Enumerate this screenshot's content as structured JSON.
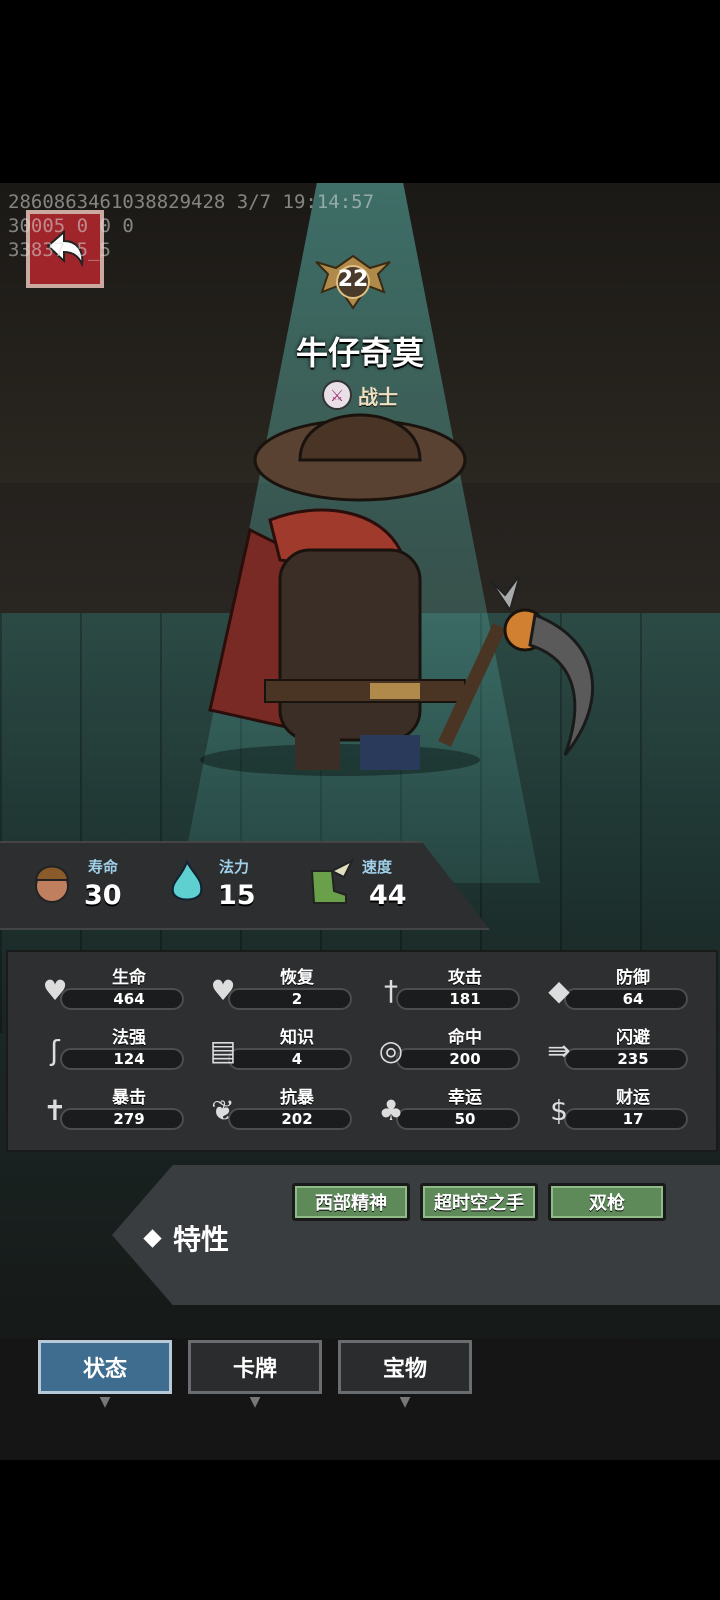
{
  "debug": {
    "line1": "28608634610388294​28 3/7 19:14:57",
    "line2": "30005 0 0 0",
    "line3": "33837 5_5"
  },
  "hero": {
    "level": "22",
    "name": "牛仔奇莫",
    "class_name": "战士"
  },
  "top_stats": [
    {
      "label": "寿命",
      "value": "30",
      "icon": "hero-portrait-icon"
    },
    {
      "label": "法力",
      "value": "15",
      "icon": "blue-flame-icon"
    },
    {
      "label": "速度",
      "value": "44",
      "icon": "winged-boot-icon"
    }
  ],
  "stats": [
    {
      "label": "生命",
      "value": "464",
      "icon": "heart-icon"
    },
    {
      "label": "恢复",
      "value": "2",
      "icon": "heart-plus-icon"
    },
    {
      "label": "攻击",
      "value": "181",
      "icon": "sword-icon"
    },
    {
      "label": "防御",
      "value": "64",
      "icon": "armor-icon"
    },
    {
      "label": "法强",
      "value": "124",
      "icon": "staff-icon"
    },
    {
      "label": "知识",
      "value": "4",
      "icon": "book-icon"
    },
    {
      "label": "命中",
      "value": "200",
      "icon": "target-icon"
    },
    {
      "label": "闪避",
      "value": "235",
      "icon": "dodge-arrows-icon"
    },
    {
      "label": "暴击",
      "value": "279",
      "icon": "crit-dagger-icon"
    },
    {
      "label": "抗暴",
      "value": "202",
      "icon": "shell-shield-icon"
    },
    {
      "label": "幸运",
      "value": "50",
      "icon": "clover-icon"
    },
    {
      "label": "财运",
      "value": "17",
      "icon": "coin-icon"
    }
  ],
  "traits": {
    "title": "特性",
    "items": [
      "西部精神",
      "超时空之手",
      "双枪"
    ]
  },
  "tabs": [
    {
      "label": "状态",
      "active": true
    },
    {
      "label": "卡牌",
      "active": false
    },
    {
      "label": "宝物",
      "active": false
    }
  ],
  "colors": {
    "back_button": "#a0252a",
    "trait_button": "#5e8a5a",
    "tab_active": "#3f6d8f",
    "stat_label_top": "#9fd0e8"
  }
}
